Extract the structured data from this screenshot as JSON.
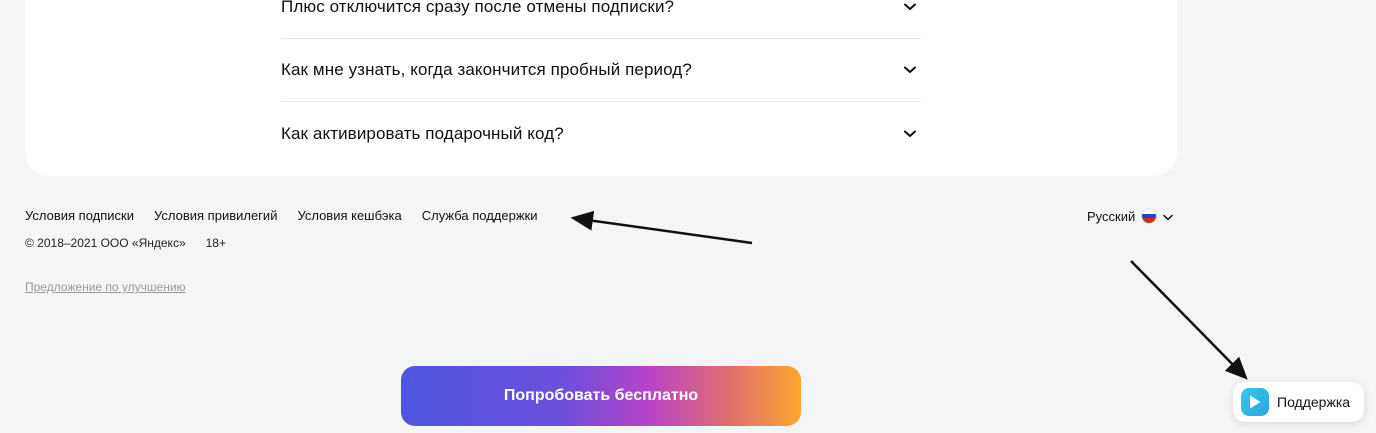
{
  "faq": {
    "items": [
      {
        "question": "Плюс отключится сразу после отмены подписки?"
      },
      {
        "question": "Как мне узнать, когда закончится пробный период?"
      },
      {
        "question": "Как активировать подарочный код?"
      }
    ]
  },
  "footer": {
    "links": [
      "Условия подписки",
      "Условия привилегий",
      "Условия кешбэка",
      "Служба поддержки"
    ],
    "copyright": "© 2018–2021 ООО «Яндекс»",
    "age_rating": "18+",
    "suggest_link": "Предложение по улучшению",
    "language": "Русский"
  },
  "cta": {
    "try_label": "Попробовать бесплатно"
  },
  "support_widget": {
    "label": "Поддержка"
  },
  "icons": {
    "chevron": "chevron-down-icon",
    "flag": "russia-flag-icon",
    "support": "support-chat-icon"
  },
  "colors": {
    "background": "#f4f5f7",
    "card": "#ffffff",
    "cta_gradient_start": "#5056e0",
    "cta_gradient_end": "#fba72e",
    "support_icon": "#35c9e8"
  }
}
